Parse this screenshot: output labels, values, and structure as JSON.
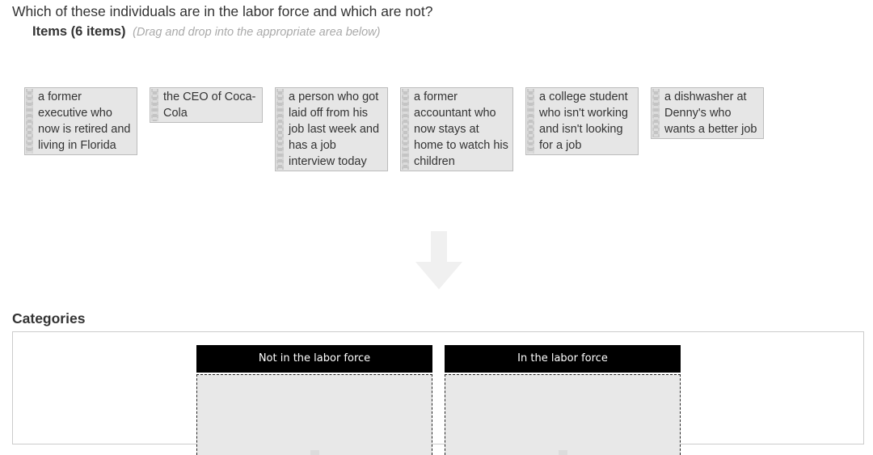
{
  "question": "Which of these individuals are in the labor force and which are not?",
  "items_section": {
    "title": "Items (6 items)",
    "hint": "(Drag and drop into the appropriate area below)",
    "items": [
      {
        "label": "a former executive who now is retired and living in Florida"
      },
      {
        "label": "the CEO of Coca-Cola"
      },
      {
        "label": "a person who got laid off from his job last week and has a job interview today"
      },
      {
        "label": "a former accountant who now stays at home to watch his children"
      },
      {
        "label": "a college student who isn't working and isn't looking for a job"
      },
      {
        "label": "a dishwasher at Denny's who wants a better job"
      }
    ]
  },
  "arrow_icon": "arrow-down-icon",
  "categories_section": {
    "title": "Categories",
    "categories": [
      {
        "label": "Not in the labor force"
      },
      {
        "label": "In the labor force"
      }
    ]
  },
  "colors": {
    "item_bg": "#e6e6e6",
    "category_header_bg": "#000000",
    "category_header_text": "#ffffff",
    "drop_zone_bg": "#e8e8e8",
    "hint_text": "#aaaaaa"
  }
}
